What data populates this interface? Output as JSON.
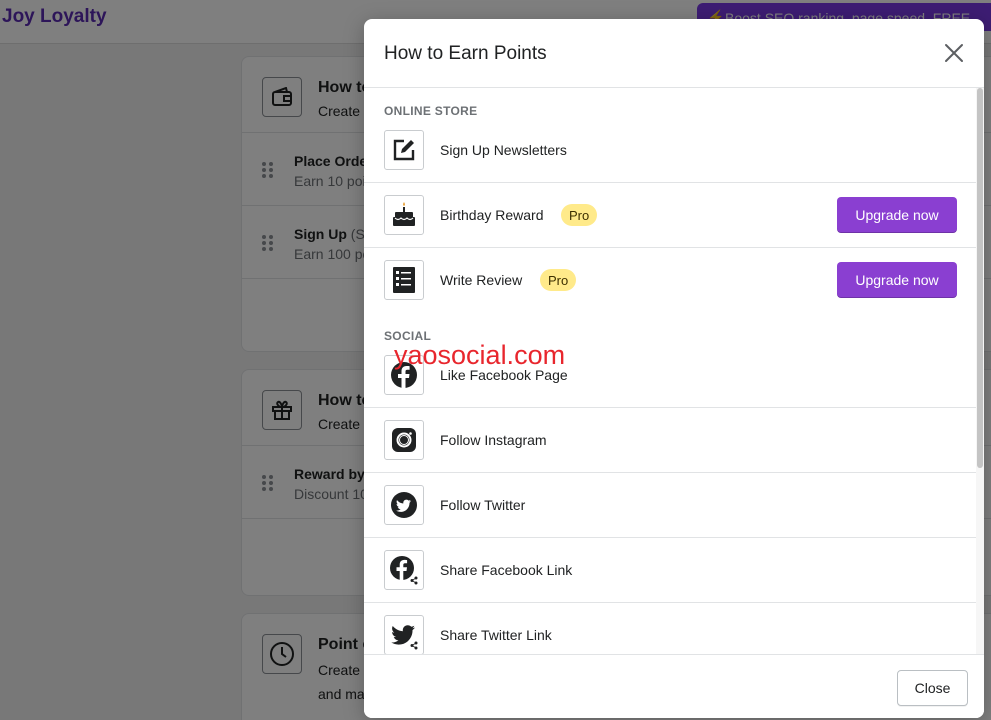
{
  "app": {
    "brand": "Joy Loyalty",
    "promo_text": "Boost SEO ranking, page speed. FREE"
  },
  "background": {
    "earn_card": {
      "title": "How to",
      "subtitle": "Create",
      "rows": [
        {
          "title": "Place Orde",
          "muted": "",
          "sub": "Earn 10 poi"
        },
        {
          "title": "Sign Up",
          "muted": " (S",
          "sub": "Earn 100 pc"
        }
      ]
    },
    "redeem_card": {
      "title": "How to",
      "subtitle": "Create",
      "rows": [
        {
          "title": "Reward by",
          "sub": "Discount 10"
        }
      ]
    },
    "expiry_card": {
      "title": "Point e",
      "subtitle_line1": "Create",
      "subtitle_line2": "and ma"
    }
  },
  "modal": {
    "title": "How to Earn Points",
    "sections": {
      "online_store": {
        "label": "ONLINE STORE",
        "items": [
          {
            "label": "Sign Up Newsletters",
            "icon": "edit-icon"
          },
          {
            "label": "Birthday Reward",
            "icon": "birthday-cake-icon",
            "badge": "Pro",
            "action": "Upgrade now"
          },
          {
            "label": "Write Review",
            "icon": "review-list-icon",
            "badge": "Pro",
            "action": "Upgrade now"
          }
        ]
      },
      "social": {
        "label": "SOCIAL",
        "items": [
          {
            "label": "Like Facebook Page",
            "icon": "facebook-icon"
          },
          {
            "label": "Follow Instagram",
            "icon": "instagram-icon"
          },
          {
            "label": "Follow Twitter",
            "icon": "twitter-icon"
          },
          {
            "label": "Share Facebook Link",
            "icon": "facebook-share-icon"
          },
          {
            "label": "Share Twitter Link",
            "icon": "twitter-share-icon"
          }
        ]
      }
    },
    "close_label": "Close"
  },
  "watermark": "yaosocial.com",
  "colors": {
    "primary": "#8a3fd1",
    "brand": "#5b2bb3",
    "badge": "#ffea8a",
    "watermark": "#e8262d"
  }
}
